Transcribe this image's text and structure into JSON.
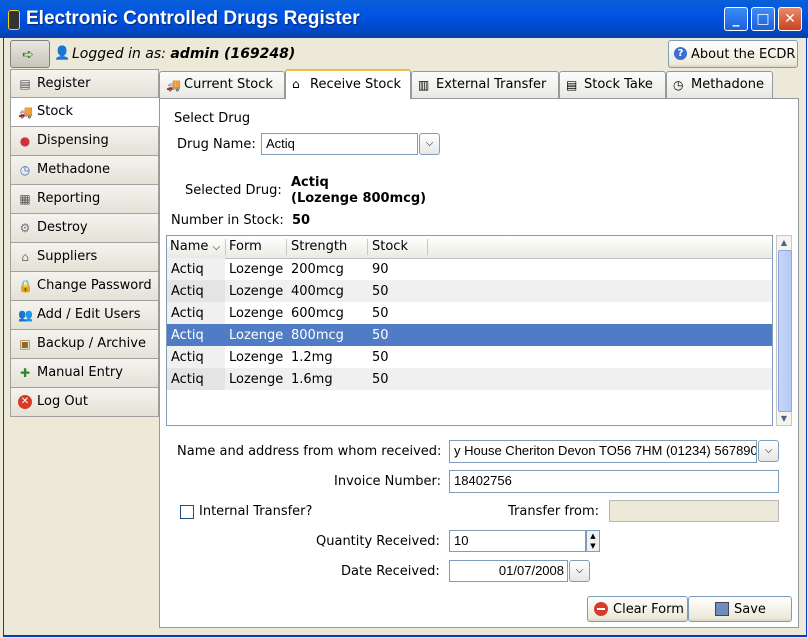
{
  "window": {
    "title": "Electronic Controlled Drugs Register",
    "min": "_",
    "max": "□",
    "close": "✕"
  },
  "header": {
    "logged_in_prefix": "Logged in as:",
    "user": "admin (169248)",
    "about_label": "About the ECDR"
  },
  "sidebar": {
    "items": [
      {
        "label": "Register",
        "icon": "register-icon"
      },
      {
        "label": "Stock",
        "icon": "truck-icon"
      },
      {
        "label": "Dispensing",
        "icon": "pill-icon"
      },
      {
        "label": "Methadone",
        "icon": "clock-icon"
      },
      {
        "label": "Reporting",
        "icon": "report-icon"
      },
      {
        "label": "Destroy",
        "icon": "destroy-icon"
      },
      {
        "label": "Suppliers",
        "icon": "supplier-icon"
      },
      {
        "label": "Change Password",
        "icon": "lock-icon"
      },
      {
        "label": "Add / Edit Users",
        "icon": "users-icon"
      },
      {
        "label": "Backup / Archive",
        "icon": "archive-icon"
      },
      {
        "label": "Manual Entry",
        "icon": "manual-entry-icon"
      },
      {
        "label": "Log Out",
        "icon": "logout-icon"
      }
    ],
    "active_index": 1
  },
  "tabs": [
    {
      "label": "Current Stock",
      "icon": "truck-icon"
    },
    {
      "label": "Receive Stock",
      "icon": "receive-icon"
    },
    {
      "label": "External Transfer",
      "icon": "transfer-icon"
    },
    {
      "label": "Stock Take",
      "icon": "clipboard-icon"
    },
    {
      "label": "Methadone",
      "icon": "clock-icon"
    }
  ],
  "active_tab": 1,
  "form": {
    "select_drug_heading": "Select Drug",
    "drug_name_label": "Drug Name:",
    "drug_name_value": "Actiq",
    "selected_drug_label": "Selected Drug:",
    "selected_drug_line1": "Actiq",
    "selected_drug_line2": "(Lozenge 800mcg)",
    "number_in_stock_label": "Number in Stock:",
    "number_in_stock_value": "50",
    "received_from_label": "Name and address from whom received:",
    "received_from_value": "y House Cheriton Devon TO56 7HM (01234) 567890)",
    "invoice_label": "Invoice Number:",
    "invoice_value": "18402756",
    "internal_transfer_label": "Internal Transfer?",
    "transfer_from_label": "Transfer from:",
    "transfer_from_value": "",
    "quantity_label": "Quantity Received:",
    "quantity_value": "10",
    "date_label": "Date Received:",
    "date_value": "01/07/2008",
    "clear_label": "Clear Form",
    "save_label": "Save"
  },
  "table": {
    "columns": [
      "Name",
      "Form",
      "Strength",
      "Stock"
    ],
    "rows": [
      {
        "name": "Actiq",
        "form": "Lozenge",
        "strength": "200mcg",
        "stock": "90"
      },
      {
        "name": "Actiq",
        "form": "Lozenge",
        "strength": "400mcg",
        "stock": "50"
      },
      {
        "name": "Actiq",
        "form": "Lozenge",
        "strength": "600mcg",
        "stock": "50"
      },
      {
        "name": "Actiq",
        "form": "Lozenge",
        "strength": "800mcg",
        "stock": "50"
      },
      {
        "name": "Actiq",
        "form": "Lozenge",
        "strength": "1.2mg",
        "stock": "50"
      },
      {
        "name": "Actiq",
        "form": "Lozenge",
        "strength": "1.6mg",
        "stock": "50"
      }
    ],
    "selected_row": 3
  },
  "colors": {
    "titlebar": "#0054e3",
    "selection": "#4f7cc4",
    "active_tab_accent": "#f5b94d"
  }
}
